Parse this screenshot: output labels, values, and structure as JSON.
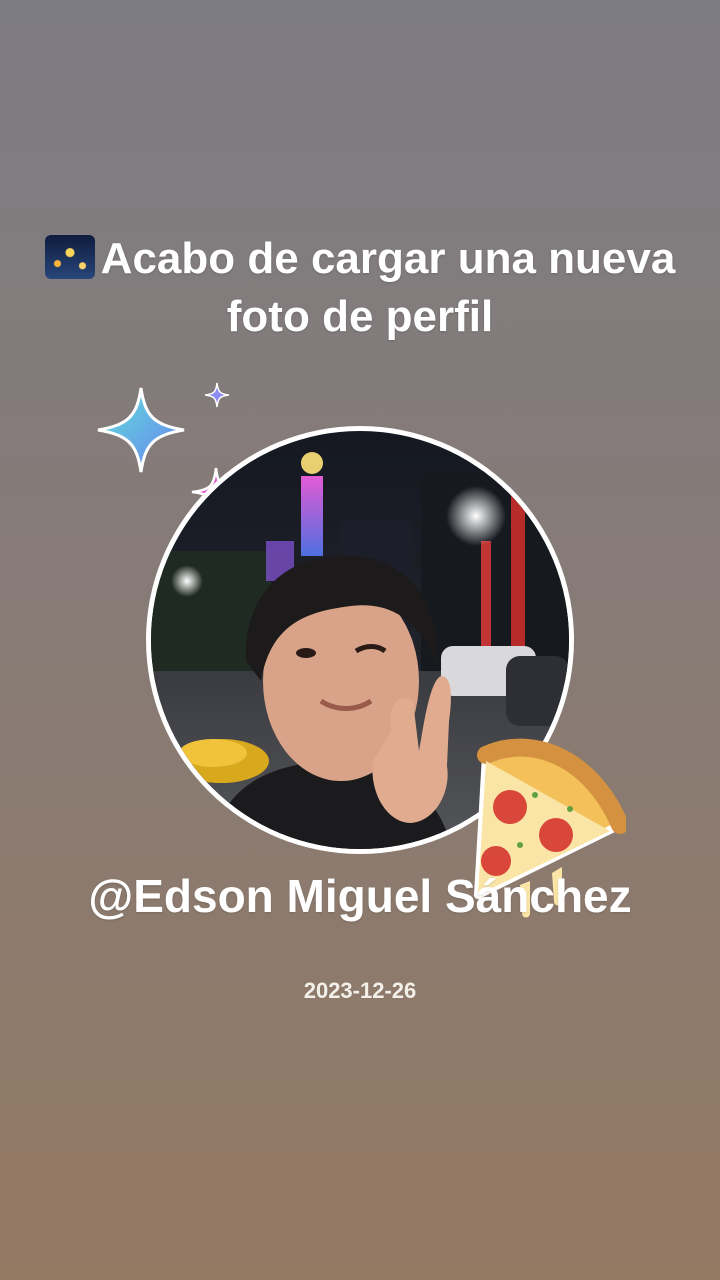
{
  "post": {
    "headline_icon": "fireworks-emoji",
    "headline": "Acabo de cargar una nueva foto de perfil",
    "username": "@Edson Miguel Sánchez",
    "date": "2023-12-26"
  },
  "decorations": [
    "sparkle-icon",
    "pizza-icon"
  ],
  "colors": {
    "background_top": "#7d7c83",
    "background_bottom": "#947a63",
    "text": "#ffffff",
    "avatar_ring": "#ffffff"
  }
}
